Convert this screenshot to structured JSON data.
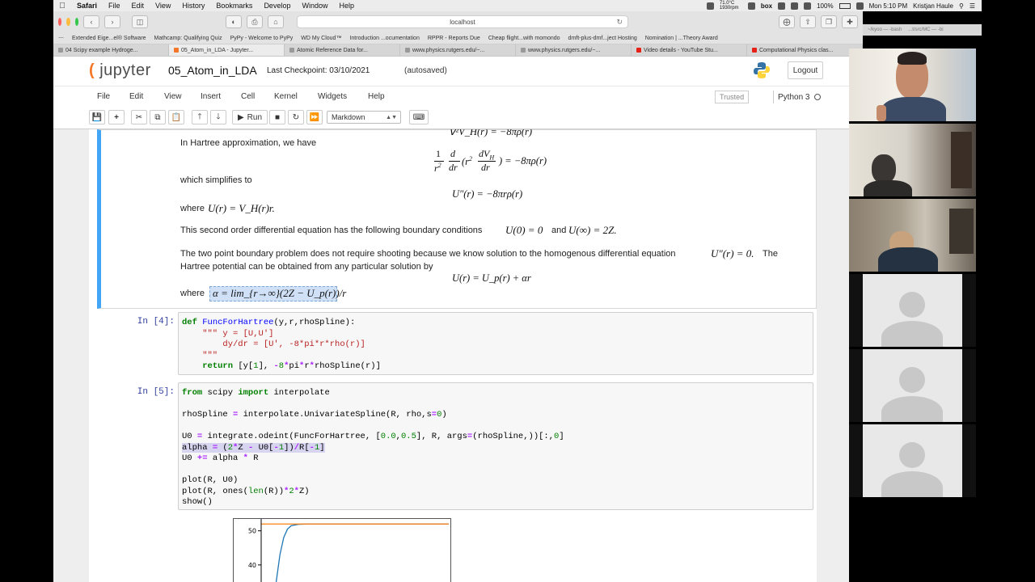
{
  "menubar": {
    "app": "Safari",
    "items": [
      "File",
      "Edit",
      "View",
      "History",
      "Bookmarks",
      "Develop",
      "Window",
      "Help"
    ],
    "weather": "71.0°C 1930rpm",
    "battery": "100%",
    "clock": "Mon 5:10 PM",
    "user": "Kristjan Haule"
  },
  "browser": {
    "url": "localhost",
    "bookmarks": [
      "Extended Eige...el® Software",
      "Mathcamp: Qualifying Quiz",
      "PyPy - Welcome to PyPy",
      "WD My Cloud™",
      "Introduction ...ocumentation",
      "RPPR - Reports Due",
      "Cheap flight...with momondo",
      "dmft-plus-dmf...ject Hosting",
      "Nomination | ...Theory Award"
    ],
    "tabs": [
      "04 Scipy example Hydroge...",
      "05_Atom_in_LDA - Jupyter...",
      "Atomic Reference Data for...",
      "www.physics.rutgers.edu/~...",
      "www.physics.rutgers.edu/~...",
      "Video details - YouTube Stu...",
      "Computational Physics clas..."
    ],
    "terminal_tabs": [
      "~/kyoo — -bash",
      "...t/src/MC — -bi"
    ]
  },
  "jupyter": {
    "logo": "jupyter",
    "notebook_name": "05_Atom_in_LDA",
    "checkpoint": "Last Checkpoint: 03/10/2021",
    "autosave": "(autosaved)",
    "logout": "Logout",
    "menu": [
      "File",
      "Edit",
      "View",
      "Insert",
      "Cell",
      "Kernel",
      "Widgets",
      "Help"
    ],
    "trusted": "Trusted",
    "kernel": "Python 3",
    "run_label": "Run",
    "cell_type": "Markdown"
  },
  "markdown": {
    "top_eq": "∇²V_H(r) = −8πρ(r)",
    "line1": "In Hartree approximation, we have",
    "eq1_rhs": ") = −8πρ(r)",
    "line2": "which simplifies to",
    "eq2": "U″(r) = −8πrρ(r)",
    "line3_text": "where",
    "line3_math": "U(r) = V_H(r)r.",
    "line4_text": "This second order differential equation has the following boundary conditions",
    "line4_math1": "U(0) = 0",
    "line4_and": "and",
    "line4_math2": "U(∞) = 2Z.",
    "line5_text": "The two point boundary problem does not require shooting because we know solution to the homogenous differential equation",
    "line5_math": "U″(r) = 0.",
    "line5_end": "The",
    "line6": "Hartree potential can be obtained from any particular solution by",
    "eq3": "U(r) = U_p(r) + αr",
    "line7_text": "where",
    "line7_math": "α = lim_{r→∞}(2Z − U_p(r))/r"
  },
  "cells": [
    {
      "prompt": "In [4]:",
      "lines": [
        "def FuncForHartree(y,r,rhoSpline):",
        "    \"\"\" y = [U,U']",
        "        dy/dr = [U', -8*pi*r*rho(r)]",
        "    \"\"\"",
        "    return [y[1], -8*pi*r*rhoSpline(r)]"
      ]
    },
    {
      "prompt": "In [5]:",
      "lines": [
        "from scipy import interpolate",
        "",
        "rhoSpline = interpolate.UnivariateSpline(R, rho,s=0)",
        "",
        "U0 = integrate.odeint(FuncForHartree, [0.0,0.5], R, args=(rhoSpline,))[:,0]",
        "alpha = (2*Z - U0[-1])/R[-1]",
        "U0 += alpha * R",
        "",
        "plot(R, U0)",
        "plot(R, ones(len(R))*2*Z)",
        "show()"
      ]
    }
  ],
  "plot": {
    "yticks": [
      "50",
      "40"
    ]
  },
  "chart_data": {
    "type": "line",
    "title": "",
    "xlabel": "",
    "ylabel": "",
    "ylim": [
      35,
      53
    ],
    "xlim": [
      0,
      1
    ],
    "series": [
      {
        "color": "#1f77b4",
        "x": [
          0.08,
          0.1,
          0.12,
          0.14,
          0.16,
          0.2,
          0.25,
          0.35,
          1.0
        ],
        "y": [
          35,
          43,
          48,
          50.5,
          51.5,
          51.9,
          52,
          52,
          52
        ]
      },
      {
        "color": "#ff7f0e",
        "x": [
          0.0,
          1.0
        ],
        "y": [
          52,
          52
        ]
      }
    ]
  }
}
